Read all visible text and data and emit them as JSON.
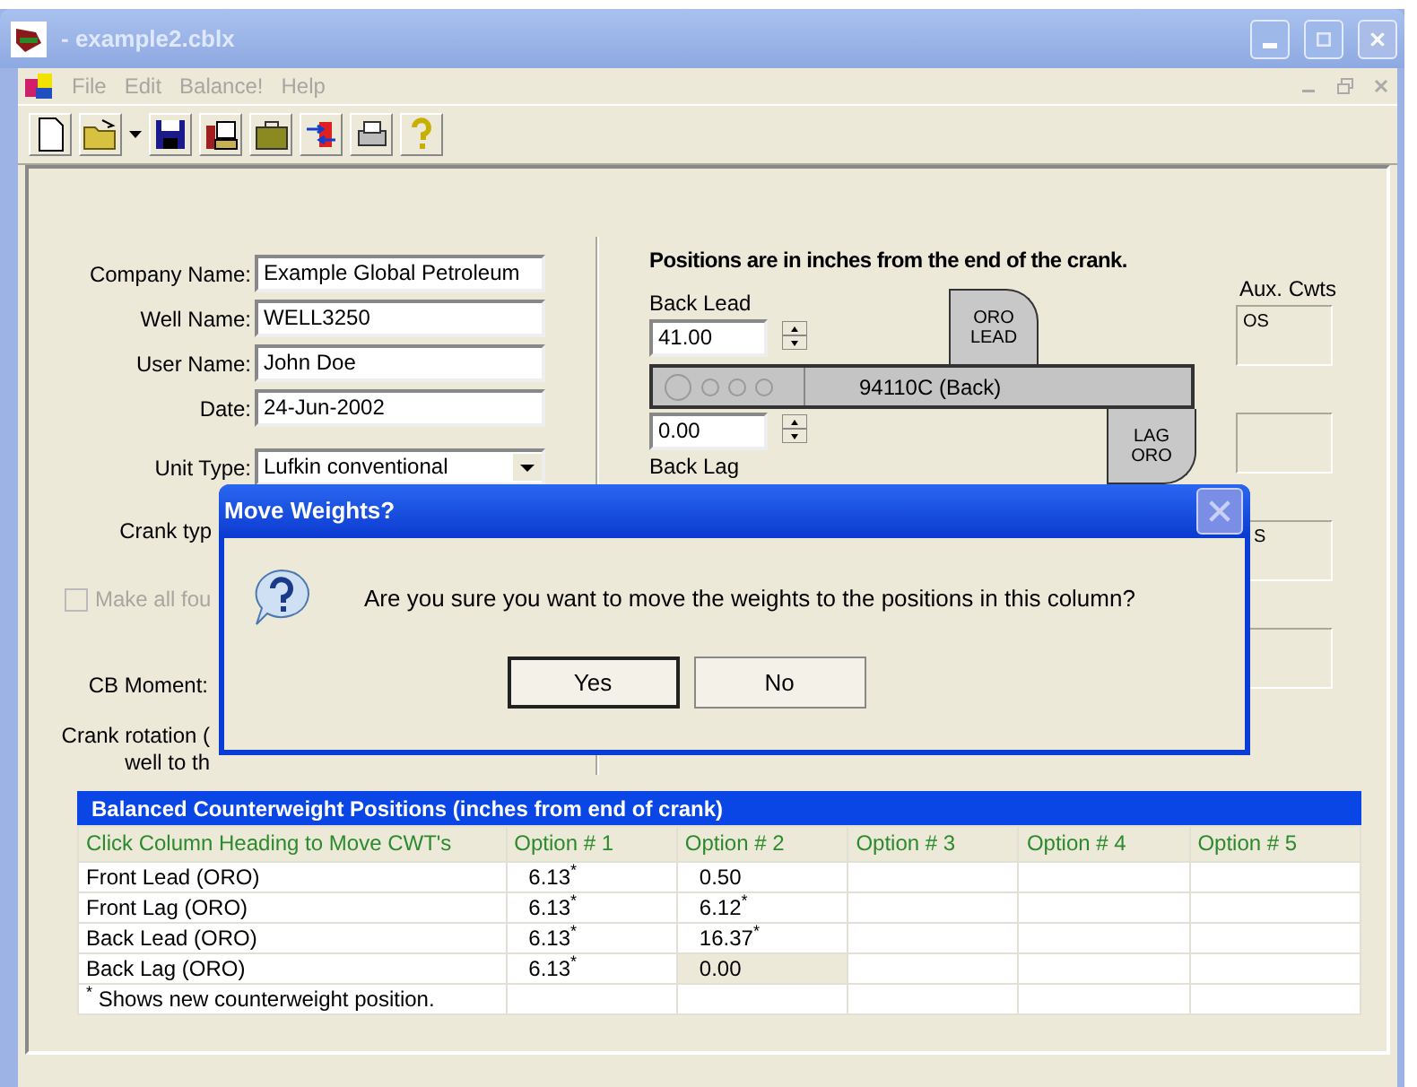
{
  "window": {
    "title": "- example2.cblx"
  },
  "menu": [
    {
      "label": "File",
      "disabled": true
    },
    {
      "label": "Edit",
      "disabled": true
    },
    {
      "label": "Balance!",
      "disabled": true
    },
    {
      "label": "Help",
      "disabled": true
    }
  ],
  "form": {
    "fields": [
      {
        "label": "Company Name:",
        "value": "Example Global Petroleum"
      },
      {
        "label": "Well Name:",
        "value": "WELL3250"
      },
      {
        "label": "User Name:",
        "value": "John Doe"
      },
      {
        "label": "Date:",
        "value": "24-Jun-2002"
      }
    ],
    "unit_type": {
      "label": "Unit Type:",
      "value": "Lufkin conventional"
    },
    "crank_type": {
      "label": "Crank typ"
    },
    "make_all": {
      "label": "Make all fou",
      "checked": false,
      "disabled": true
    },
    "cb_moment": {
      "label": "CB Moment:"
    },
    "crank_rotation": [
      "Crank rotation (",
      "well to th"
    ]
  },
  "positions": {
    "heading": "Positions are in inches from the end of the crank.",
    "back_lead": {
      "label": "Back Lead",
      "value": "41.00"
    },
    "crank": {
      "label": "94110C (Back)"
    },
    "back_lag": {
      "label": "Back Lag",
      "value": "0.00"
    },
    "lead_tag": [
      "ORO",
      "LEAD"
    ],
    "lag_tag": [
      "LAG",
      "ORO"
    ],
    "aux": {
      "label": "Aux. Cwts",
      "boxes": [
        "OS",
        "S"
      ]
    }
  },
  "dialog": {
    "title": "Move Weights?",
    "message": "Are you sure you want to move the weights to the positions in this column?",
    "buttons": [
      {
        "label": "Yes",
        "default": true
      },
      {
        "label": "No",
        "default": false
      }
    ]
  },
  "table": {
    "title": "Balanced Counterweight Positions (inches from end of crank)",
    "columns": [
      "Click Column Heading to Move CWT's",
      "Option # 1",
      "Option # 2",
      "Option # 3",
      "Option # 4",
      "Option # 5"
    ],
    "rows": [
      {
        "cells": [
          {
            "text": "Front Lead (ORO)",
            "selected": false
          },
          {
            "text": "6.13$^{*}$",
            "selected": false
          },
          {
            "text": "0.50",
            "selected": false
          }
        ]
      },
      {
        "cells": [
          {
            "text": "Front Lag (ORO)",
            "selected": false
          },
          {
            "text": "6.13$^{*}$",
            "selected": false
          },
          {
            "text": "6.12$^{*}$",
            "selected": false
          }
        ]
      },
      {
        "cells": [
          {
            "text": "Back Lead (ORO)",
            "selected": false
          },
          {
            "text": "6.13$^{*}$",
            "selected": false
          },
          {
            "text": "16.37$^{*}$",
            "selected": false
          }
        ]
      },
      {
        "cells": [
          {
            "text": "Back Lag (ORO)",
            "selected": false
          },
          {
            "text": "6.13$^{*}$",
            "selected": false
          },
          {
            "text": "0.00",
            "selected": true
          }
        ]
      }
    ],
    "footnote": "$^{*}$ Shows new counterweight position."
  }
}
